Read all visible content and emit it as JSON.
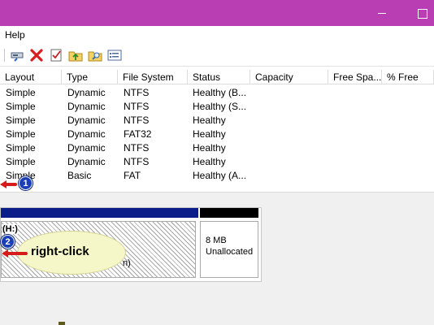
{
  "window": {
    "accent": "#b93db3"
  },
  "menu": {
    "help": "Help"
  },
  "toolbar": {
    "icons": [
      "drive-properties-icon",
      "delete-icon",
      "checklist-icon",
      "folder-up-icon",
      "folder-search-icon",
      "settings-list-icon"
    ]
  },
  "table": {
    "headers": [
      "Layout",
      "Type",
      "File System",
      "Status",
      "Capacity",
      "Free Spa...",
      "% Free"
    ],
    "rows": [
      [
        "Simple",
        "Dynamic",
        "NTFS",
        "Healthy (B...",
        "",
        "",
        ""
      ],
      [
        "Simple",
        "Dynamic",
        "NTFS",
        "Healthy (S...",
        "",
        "",
        ""
      ],
      [
        "Simple",
        "Dynamic",
        "NTFS",
        "Healthy",
        "",
        "",
        ""
      ],
      [
        "Simple",
        "Dynamic",
        "FAT32",
        "Healthy",
        "",
        "",
        ""
      ],
      [
        "Simple",
        "Dynamic",
        "NTFS",
        "Healthy",
        "",
        "",
        ""
      ],
      [
        "Simple",
        "Dynamic",
        "NTFS",
        "Healthy",
        "",
        "",
        ""
      ],
      [
        "Simple",
        "Basic",
        "FAT",
        "Healthy (A...",
        "",
        "",
        ""
      ]
    ]
  },
  "disk": {
    "partition_h": {
      "label": "(H:)",
      "tail": "n)"
    },
    "unallocated": {
      "size": "8 MB",
      "state": "Unallocated"
    }
  },
  "annotations": {
    "step1": "1",
    "step2": "2",
    "callout": "right-click"
  }
}
